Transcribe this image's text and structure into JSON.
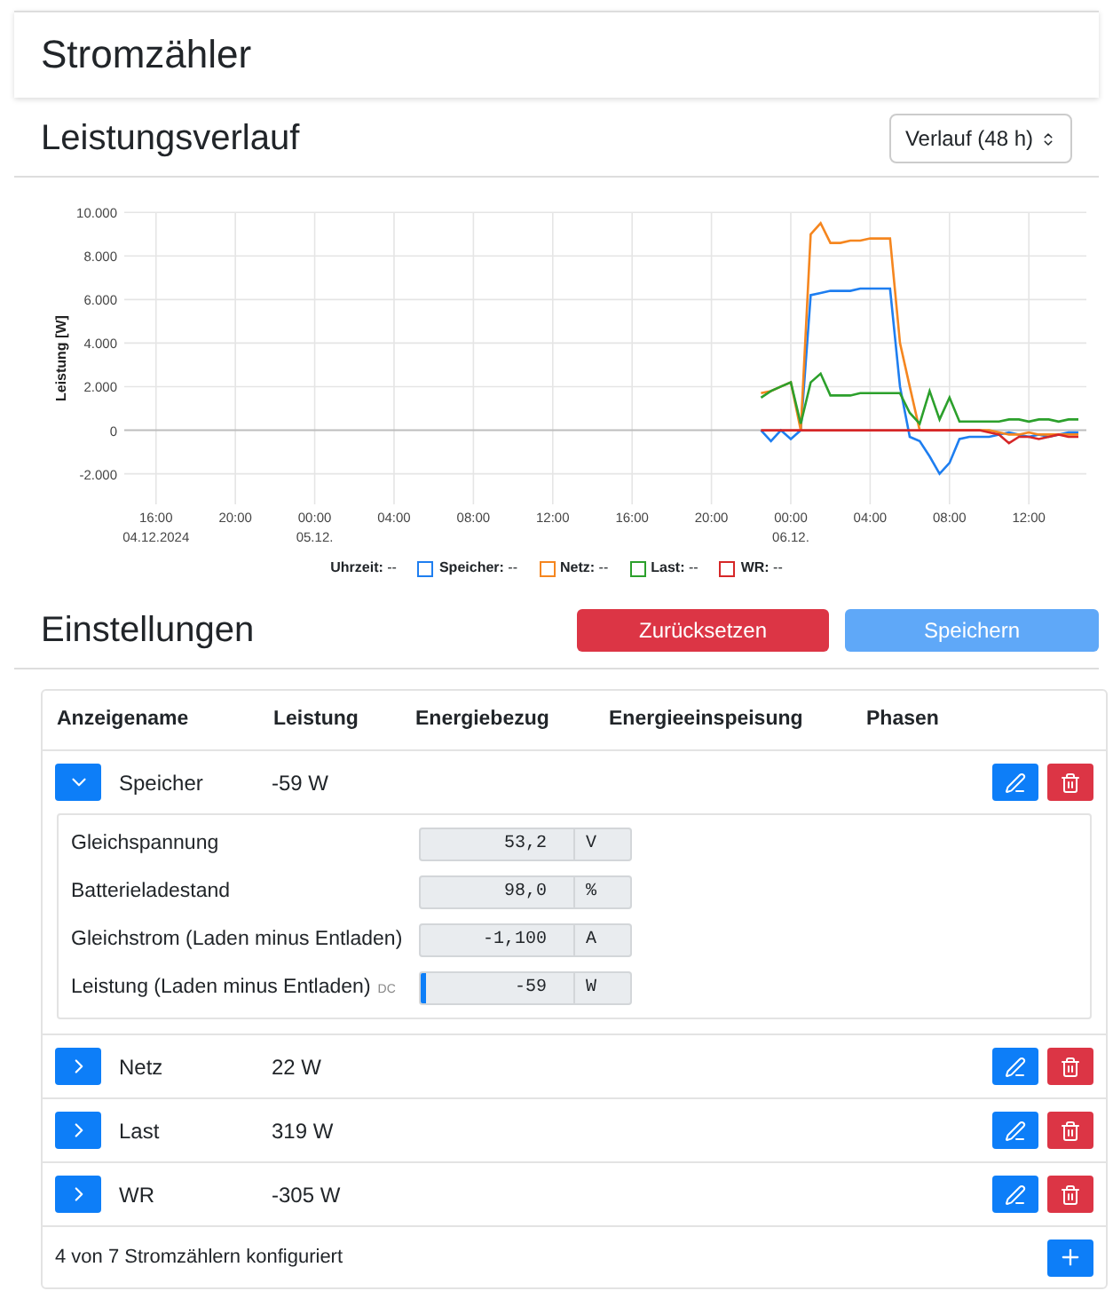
{
  "page_title": "Stromzähler",
  "history": {
    "title": "Leistungsverlauf",
    "range_select": {
      "value": "Verlauf (48 h)"
    },
    "date_labels": [
      "04.12.2024",
      "05.12.",
      "06.12."
    ],
    "chart_data": {
      "type": "line",
      "grid": true,
      "ylabel": "Leistung [W]",
      "ylim": [
        -3400,
        10000
      ],
      "yticks": [
        {
          "value": -2000,
          "label": "-2.000"
        },
        {
          "value": 0,
          "label": "0"
        },
        {
          "value": 2000,
          "label": "2.000"
        },
        {
          "value": 4000,
          "label": "4.000"
        },
        {
          "value": 6000,
          "label": "6.000"
        },
        {
          "value": 8000,
          "label": "8.000"
        },
        {
          "value": 10000,
          "label": "10.000"
        }
      ],
      "categories": [
        null,
        null,
        null,
        "16:00",
        null,
        null,
        null,
        null,
        null,
        null,
        null,
        "20:00",
        null,
        null,
        null,
        null,
        null,
        null,
        null,
        "00:00",
        null,
        null,
        null,
        null,
        null,
        null,
        null,
        "04:00",
        null,
        null,
        null,
        null,
        null,
        null,
        null,
        "08:00",
        null,
        null,
        null,
        null,
        null,
        null,
        null,
        "12:00",
        null,
        null,
        null,
        null,
        null,
        null,
        null,
        "16:00",
        null,
        null,
        null,
        null,
        null,
        null,
        null,
        "20:00",
        null,
        null,
        null,
        null,
        null,
        null,
        null,
        "00:00",
        null,
        null,
        null,
        null,
        null,
        null,
        null,
        "04:00",
        null,
        null,
        null,
        null,
        null,
        null,
        null,
        "08:00",
        null,
        null,
        null,
        null,
        null,
        null,
        null,
        "12:00",
        null,
        null,
        null,
        null,
        null
      ],
      "series": [
        {
          "color": "#1e7ef0",
          "values": [
            null,
            null,
            null,
            null,
            null,
            null,
            null,
            null,
            null,
            null,
            null,
            null,
            null,
            null,
            null,
            null,
            null,
            null,
            null,
            null,
            null,
            null,
            null,
            null,
            null,
            null,
            null,
            null,
            null,
            null,
            null,
            null,
            null,
            null,
            null,
            null,
            null,
            null,
            null,
            null,
            null,
            null,
            null,
            null,
            null,
            null,
            null,
            null,
            null,
            null,
            null,
            null,
            null,
            null,
            null,
            null,
            null,
            null,
            null,
            null,
            null,
            null,
            null,
            null,
            0,
            -500,
            0,
            -400,
            0,
            6200,
            6300,
            6400,
            6400,
            6400,
            6500,
            6500,
            6500,
            6500,
            2000,
            -300,
            -500,
            -1200,
            -2000,
            -1500,
            -400,
            -300,
            -300,
            -300,
            -200,
            -100,
            -200,
            -300,
            -200,
            -300,
            -200,
            -100,
            -100
          ]
        },
        {
          "color": "#f5861f",
          "values": [
            null,
            null,
            null,
            null,
            null,
            null,
            null,
            null,
            null,
            null,
            null,
            null,
            null,
            null,
            null,
            null,
            null,
            null,
            null,
            null,
            null,
            null,
            null,
            null,
            null,
            null,
            null,
            null,
            null,
            null,
            null,
            null,
            null,
            null,
            null,
            null,
            null,
            null,
            null,
            null,
            null,
            null,
            null,
            null,
            null,
            null,
            null,
            null,
            null,
            null,
            null,
            null,
            null,
            null,
            null,
            null,
            null,
            null,
            null,
            null,
            null,
            null,
            null,
            null,
            1700,
            1800,
            2000,
            2200,
            0,
            9000,
            9500,
            8600,
            8600,
            8700,
            8700,
            8800,
            8800,
            8800,
            4000,
            2000,
            0,
            0,
            0,
            0,
            0,
            0,
            0,
            0,
            -100,
            -200,
            -200,
            -100,
            -200,
            -200,
            -200,
            -200,
            -200
          ]
        },
        {
          "color": "#2ca02c",
          "values": [
            null,
            null,
            null,
            null,
            null,
            null,
            null,
            null,
            null,
            null,
            null,
            null,
            null,
            null,
            null,
            null,
            null,
            null,
            null,
            null,
            null,
            null,
            null,
            null,
            null,
            null,
            null,
            null,
            null,
            null,
            null,
            null,
            null,
            null,
            null,
            null,
            null,
            null,
            null,
            null,
            null,
            null,
            null,
            null,
            null,
            null,
            null,
            null,
            null,
            null,
            null,
            null,
            null,
            null,
            null,
            null,
            null,
            null,
            null,
            null,
            null,
            null,
            null,
            null,
            1500,
            1800,
            2000,
            2200,
            300,
            2200,
            2600,
            1600,
            1600,
            1600,
            1700,
            1700,
            1700,
            1700,
            1700,
            800,
            300,
            1800,
            500,
            1500,
            400,
            400,
            400,
            400,
            400,
            500,
            500,
            400,
            500,
            500,
            400,
            500,
            500
          ]
        },
        {
          "color": "#d62728",
          "values": [
            null,
            null,
            null,
            null,
            null,
            null,
            null,
            null,
            null,
            null,
            null,
            null,
            null,
            null,
            null,
            null,
            null,
            null,
            null,
            null,
            null,
            null,
            null,
            null,
            null,
            null,
            null,
            null,
            null,
            null,
            null,
            null,
            null,
            null,
            null,
            null,
            null,
            null,
            null,
            null,
            null,
            null,
            null,
            null,
            null,
            null,
            null,
            null,
            null,
            null,
            null,
            null,
            null,
            null,
            null,
            null,
            null,
            null,
            null,
            null,
            null,
            null,
            null,
            null,
            0,
            0,
            0,
            0,
            0,
            0,
            0,
            0,
            0,
            0,
            0,
            0,
            0,
            0,
            0,
            0,
            0,
            0,
            0,
            0,
            0,
            0,
            0,
            -100,
            -200,
            -600,
            -300,
            -300,
            -400,
            -300,
            -200,
            -300,
            -300
          ]
        }
      ]
    },
    "legend": {
      "time_label": "Uhrzeit:",
      "time_value": "--",
      "items": [
        {
          "label": "Speicher:",
          "value": "--",
          "color": "#1e7ef0"
        },
        {
          "label": "Netz:",
          "value": "--",
          "color": "#f5861f"
        },
        {
          "label": "Last:",
          "value": "--",
          "color": "#2ca02c"
        },
        {
          "label": "WR:",
          "value": "--",
          "color": "#d62728"
        }
      ]
    }
  },
  "settings": {
    "title": "Einstellungen",
    "reset_button": "Zurücksetzen",
    "save_button": {
      "label": "Speichern",
      "disabled": true
    },
    "table": {
      "columns": [
        "Anzeigename",
        "Leistung",
        "Energiebezug",
        "Energieeinspeisung",
        "Phasen"
      ],
      "rows": [
        {
          "name": "Speicher",
          "power": "-59 W",
          "expanded": true,
          "details": [
            {
              "label": "Gleichspannung",
              "value": "53,2",
              "unit": "V"
            },
            {
              "label": "Batterieladestand",
              "value": "98,0",
              "unit": "%"
            },
            {
              "label": "Gleichstrom (Laden minus Entladen)",
              "value": "-1,100",
              "unit": "A"
            },
            {
              "label": "Leistung (Laden minus Entladen)",
              "tag": "DC",
              "value": "-59",
              "unit": "W",
              "level": 0.02
            }
          ]
        },
        {
          "name": "Netz",
          "power": "22 W",
          "expanded": false
        },
        {
          "name": "Last",
          "power": "319 W",
          "expanded": false
        },
        {
          "name": "WR",
          "power": "-305 W",
          "expanded": false
        }
      ]
    },
    "footer": "4 von 7 Stromzählern konfiguriert"
  }
}
